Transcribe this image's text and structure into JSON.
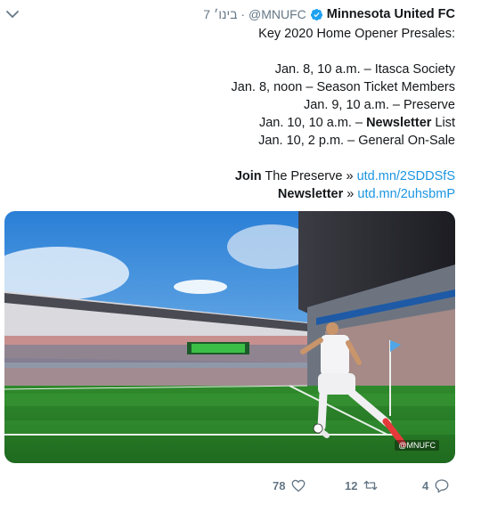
{
  "tweet": {
    "author_name": "Minnesota United FC",
    "handle": "@MNUFC",
    "time": "7 בינו׳ ·",
    "lines": [
      {
        "type": "text",
        "text": "Key 2020 Home Opener Presales:"
      },
      {
        "type": "blank"
      },
      {
        "type": "text",
        "text": "Jan. 8, 10 a.m. – Itasca Society"
      },
      {
        "type": "text",
        "text": "Jan. 8, noon – Season Ticket Members"
      },
      {
        "type": "text",
        "text": "Jan. 9, 10 a.m. – Preserve"
      },
      {
        "type": "mixed",
        "before": "Jan. 10, 10 a.m. – ",
        "bold": "Newsletter",
        "after": " List"
      },
      {
        "type": "text",
        "text": "Jan. 10, 2 p.m. – General On-Sale"
      },
      {
        "type": "blank"
      },
      {
        "type": "link",
        "bold": "Join",
        "text": " The Preserve » ",
        "link": "utd.mn/2SDDSfS"
      },
      {
        "type": "link",
        "bold": "Newsletter",
        "text": " » ",
        "link": "utd.mn/2uhsbmP"
      }
    ],
    "photo_watermark": "@MNUFC"
  },
  "actions": {
    "likes": "78",
    "retweets": "12",
    "replies": "4"
  },
  "colors": {
    "link": "#1b95e0",
    "verified": "#1da1f2",
    "muted": "#657786"
  }
}
